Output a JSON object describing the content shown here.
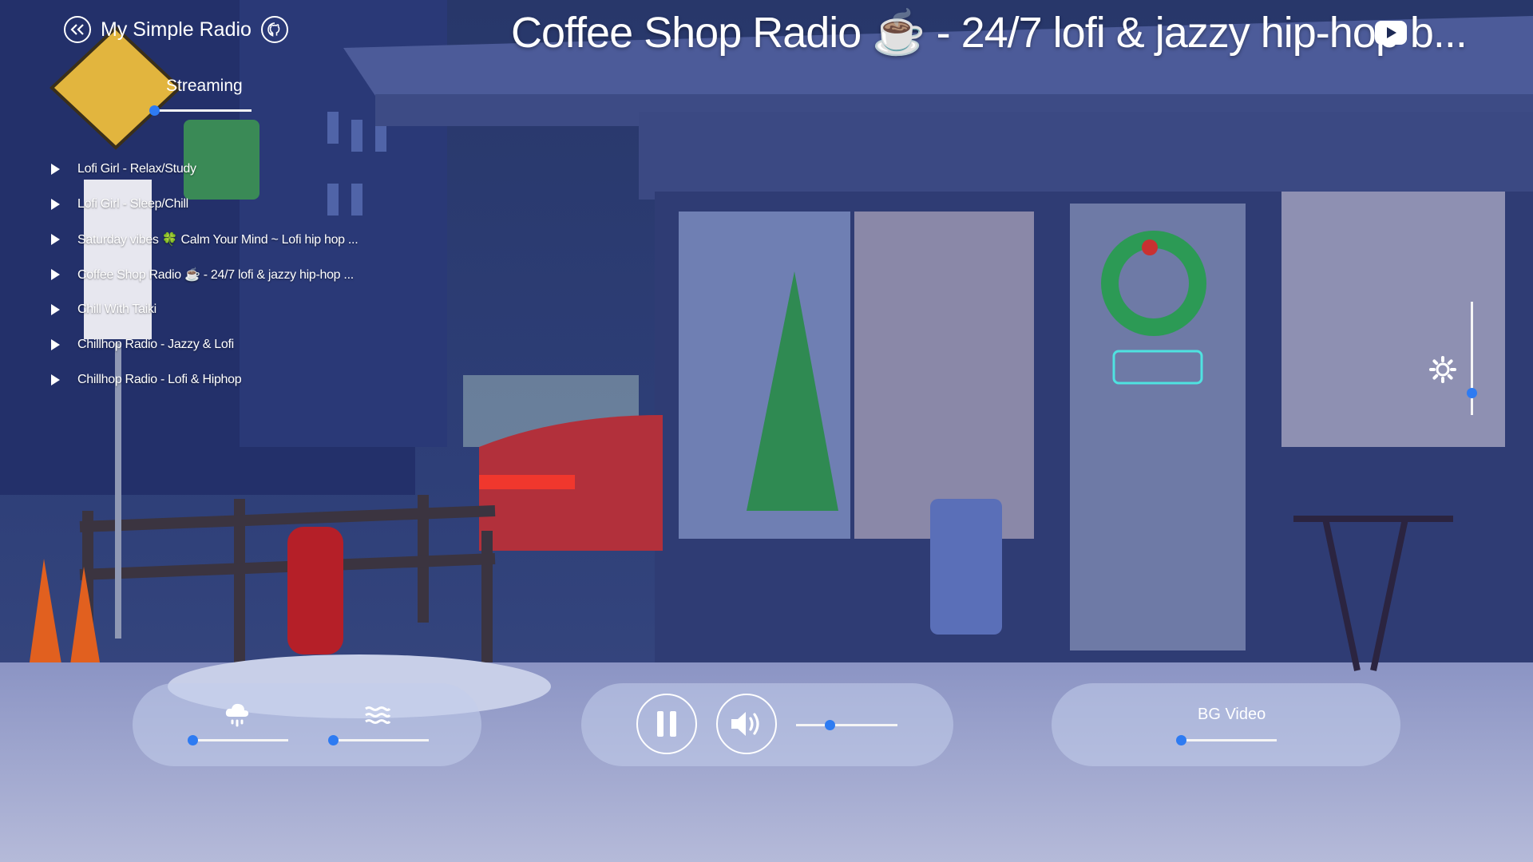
{
  "header": {
    "back_icon": "double-chevron-left-icon",
    "app_name": "My Simple Radio",
    "github_icon": "github-icon"
  },
  "streaming": {
    "label": "Streaming",
    "level": 0
  },
  "stations": [
    {
      "label": "Lofi Girl - Relax/Study"
    },
    {
      "label": "Lofi Girl - Sleep/Chill"
    },
    {
      "label": "Saturday vibes 🍀 Calm Your Mind ~ Lofi hip hop ..."
    },
    {
      "label": "Coffee Shop Radio ☕ - 24/7 lofi & jazzy hip-hop ..."
    },
    {
      "label": "Chill With Taiki"
    },
    {
      "label": "Chillhop Radio - Jazzy & Lofi"
    },
    {
      "label": "Chillhop Radio - Lofi & Hiphop"
    }
  ],
  "now_playing": {
    "title": "Coffee Shop Radio ☕ - 24/7 lofi & jazzy hip-hop b...",
    "source_icon": "youtube-icon"
  },
  "brightness": {
    "icon": "sun-icon",
    "level": 0.2
  },
  "ambience": {
    "rain": {
      "icon": "rain-cloud-icon",
      "level": 0
    },
    "wind": {
      "icon": "waves-icon",
      "level": 0
    }
  },
  "player": {
    "pause_icon": "pause-icon",
    "volume_icon": "speaker-icon",
    "volume": 0.33
  },
  "bg_video": {
    "label": "BG Video",
    "level": 0
  },
  "colors": {
    "accent": "#2e7bf2",
    "panel": "#c3cdeb",
    "night_sky": "#1d2a55"
  }
}
